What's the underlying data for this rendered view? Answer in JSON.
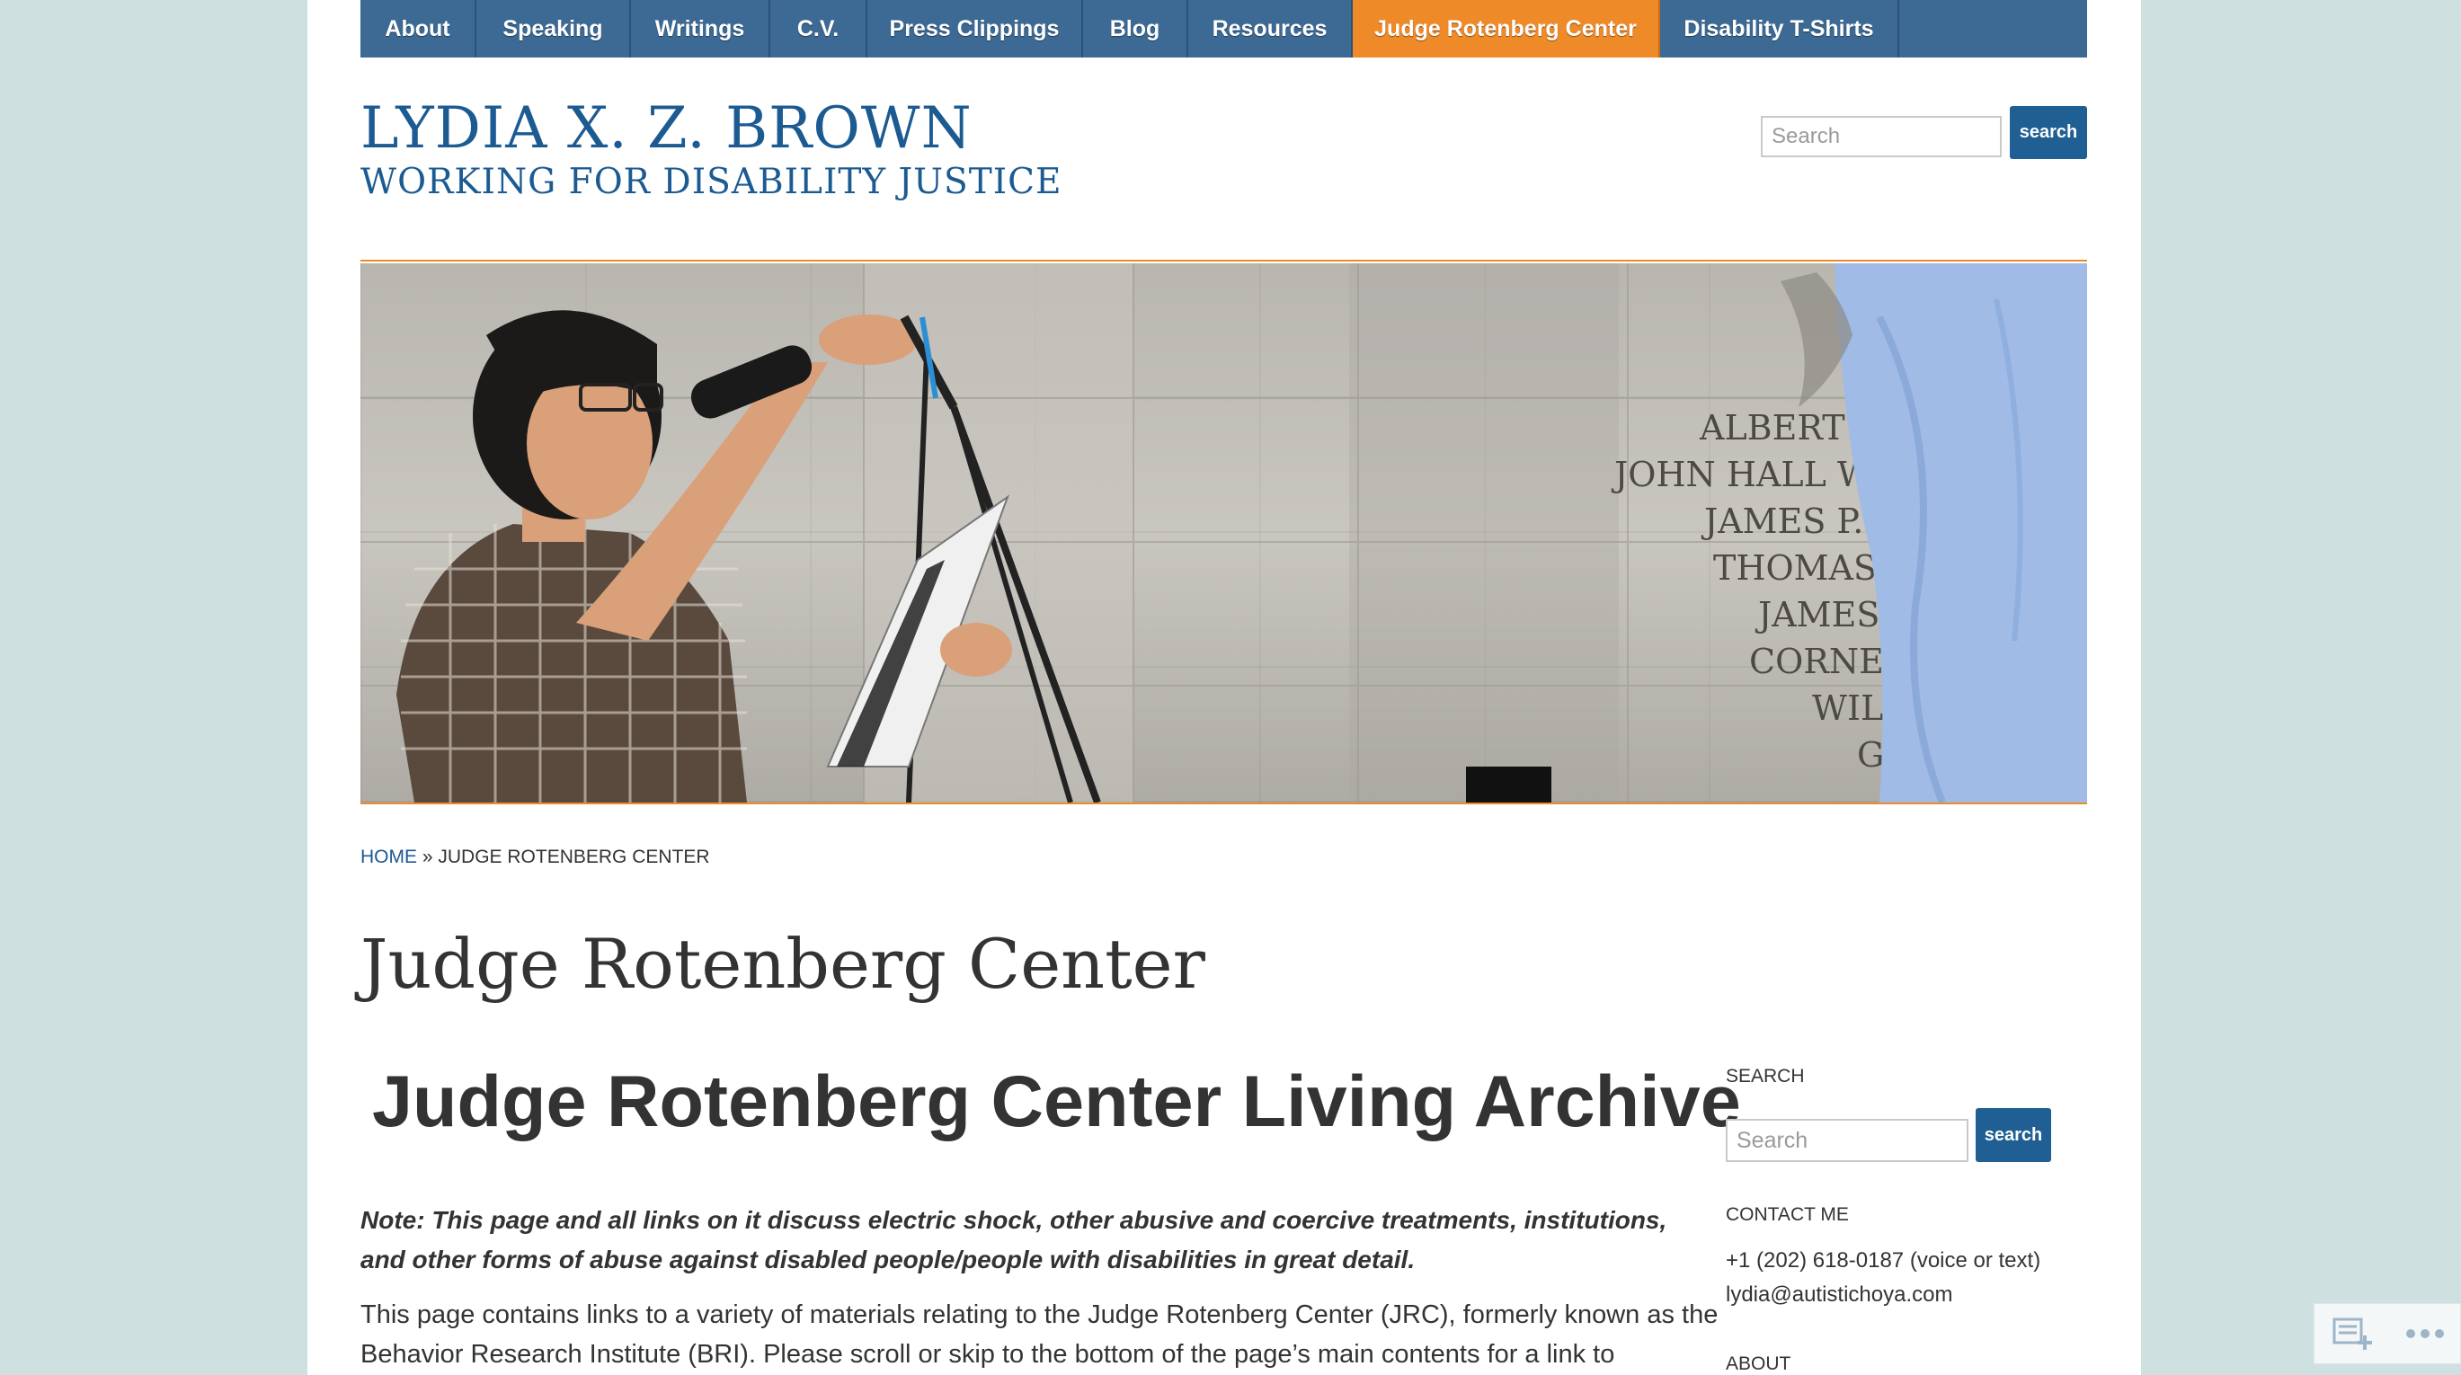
{
  "nav": {
    "items": [
      {
        "label": "About",
        "active": false
      },
      {
        "label": "Speaking",
        "active": false
      },
      {
        "label": "Writings",
        "active": false
      },
      {
        "label": "C.V.",
        "active": false
      },
      {
        "label": "Press Clippings",
        "active": false
      },
      {
        "label": "Blog",
        "active": false
      },
      {
        "label": "Resources",
        "active": false
      },
      {
        "label": "Judge Rotenberg Center",
        "active": true
      },
      {
        "label": "Disability T-Shirts",
        "active": false
      }
    ]
  },
  "site": {
    "title": "LYDIA X. Z. BROWN",
    "tagline": "WORKING FOR DISABILITY JUSTICE"
  },
  "header_search": {
    "placeholder": "Search",
    "button_label": "search"
  },
  "banner": {
    "wall_names": [
      "ALBERT EV",
      "JOHN HALL WIL",
      "JAMES P. JO",
      "THOMAS L",
      "JAMES H",
      "CORNELIU",
      "WILLI",
      "GEO"
    ]
  },
  "breadcrumb": {
    "home": "HOME",
    "separator": "»",
    "current": "JUDGE ROTENBERG CENTER"
  },
  "main": {
    "page_title": "Judge Rotenberg Center",
    "heading": "Judge Rotenberg Center Living Archive",
    "note_lines": [
      "Note: This page and all links on it discuss electric shock, other abusive and coercive treatments, institutions,",
      "and other forms of abuse against disabled people/people with disabilities in great detail."
    ],
    "body_lines": [
      "This page contains links to a variety of materials relating to the Judge Rotenberg Center (JRC), formerly known as the",
      "Behavior Research Institute (BRI). Please scroll or skip to the bottom of the page’s main contents for a link to"
    ]
  },
  "sidebar": {
    "search_label": "SEARCH",
    "search_placeholder": "Search",
    "search_button": "search",
    "contact_label": "CONTACT ME",
    "phone": "+1 (202) 618-0187 (voice or text)",
    "email": "lydia@autistichoya.com",
    "about_label": "ABOUT"
  },
  "colors": {
    "nav_bg": "#3c6a95",
    "nav_active": "#ef8a28",
    "brand_blue": "#1c5a92",
    "page_bg": "#cfe0e0"
  }
}
